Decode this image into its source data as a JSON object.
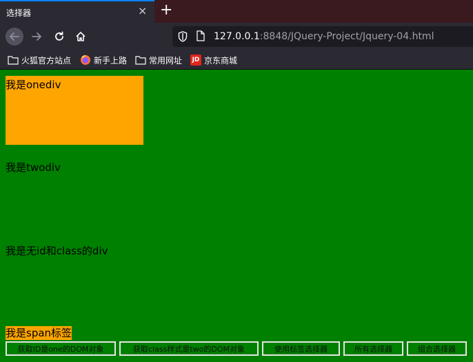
{
  "browser": {
    "tab_title": "选择器",
    "tab_close": "×",
    "new_tab": "+",
    "url_host": "127.0.0.1",
    "url_rest": ":8848/JQuery-Project/Jquery-04.html",
    "bookmarks": [
      {
        "label": "火狐官方站点",
        "icon": "folder-icon"
      },
      {
        "label": "新手上路",
        "icon": "firefox-icon"
      },
      {
        "label": "常用网址",
        "icon": "folder-icon"
      },
      {
        "label": "京东商城",
        "icon": "jd-icon"
      }
    ],
    "jd_icon_text": "JD"
  },
  "page": {
    "one_div_text": "我是onediv",
    "two_div_text": "我是twodiv",
    "plain_div_text": "我是无id和class的div",
    "span_text": "我是span标签",
    "buttons": [
      "获取ID是one的DOM对象",
      "获取class样式是two的DOM对象",
      "使用标签选择器",
      "所有选择器",
      "组合选择器"
    ]
  },
  "colors": {
    "page_bg": "#008000",
    "highlight": "#ffa500",
    "active_tab_accent": "#0a84ff"
  }
}
